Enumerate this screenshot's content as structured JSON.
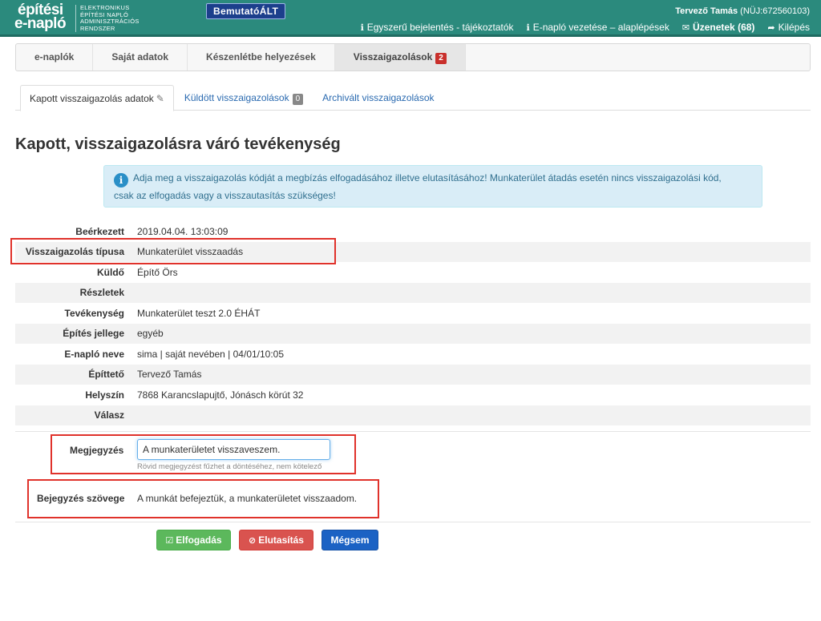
{
  "header": {
    "logo_line1": "építési",
    "logo_line2": "e-napló",
    "logo_sub": [
      "ELEKTRONIKUS",
      "ÉPÍTÉSI NAPLÓ",
      "ADMINISZTRÁCIÓS",
      "RENDSZER"
    ],
    "env_badge": "BemutatóÁLT",
    "user_name": "Tervező Tamás",
    "user_id": "(NÜJ:672560103)",
    "links": {
      "simple_login": "Egyszerű bejelentés - tájékoztatók",
      "enaplo_basics": "E-napló vezetése – alaplépések",
      "messages": "Üzenetek (68)",
      "logout": "Kilépés"
    }
  },
  "mainnav": {
    "tabs": [
      {
        "label": "e-naplók"
      },
      {
        "label": "Saját adatok"
      },
      {
        "label": "Készenlétbe helyezések"
      },
      {
        "label": "Visszaigazolások",
        "badge": "2"
      }
    ]
  },
  "subtabs": {
    "received_data": "Kapott visszaigazolás adatok",
    "sent": "Küldött visszaigazolások",
    "sent_count": "0",
    "archived": "Archivált visszaigazolások"
  },
  "page_title": "Kapott, visszaigazolásra váró tevékenység",
  "alert_text_1": "Adja meg a visszaigazolás kódját a megbízás elfogadásához illetve elutasításához! Munkaterület átadás esetén nincs visszaigazolási kód,",
  "alert_text_2": "csak az elfogadás vagy a visszautasítás szükséges!",
  "details": [
    {
      "key": "Beérkezett",
      "value": "2019.04.04. 13:03:09"
    },
    {
      "key": "Visszaigazolás típusa",
      "value": "Munkaterület visszaadás"
    },
    {
      "key": "Küldő",
      "value": "Építő Örs"
    },
    {
      "key": "Részletek",
      "value": ""
    },
    {
      "key": "Tevékenység",
      "value": "Munkaterület teszt 2.0 ÉHÁT"
    },
    {
      "key": "Építés jellege",
      "value": "egyéb"
    },
    {
      "key": "E-napló neve",
      "value": "sima | saját nevében | 04/01/10:05"
    },
    {
      "key": "Építtető",
      "value": "Tervező Tamás"
    },
    {
      "key": "Helyszín",
      "value": "7868 Karancslapujtő, Jónásch körút 32"
    },
    {
      "key": "Válasz",
      "value": ""
    }
  ],
  "note": {
    "label": "Megjegyzés",
    "value": "A munkaterületet visszaveszem.",
    "help": "Rövid megjegyzést fűzhet a döntéséhez, nem kötelező"
  },
  "entry": {
    "label": "Bejegyzés szövege",
    "value": "A munkát befejeztük, a munkaterületet visszaadom."
  },
  "buttons": {
    "accept": "Elfogadás",
    "reject": "Elutasítás",
    "cancel": "Mégsem"
  },
  "colors": {
    "header_bg": "#2b8a7d",
    "accept": "#5cb85c",
    "reject": "#d9534f",
    "cancel": "#1b62c4",
    "highlight": "#e0322b"
  }
}
